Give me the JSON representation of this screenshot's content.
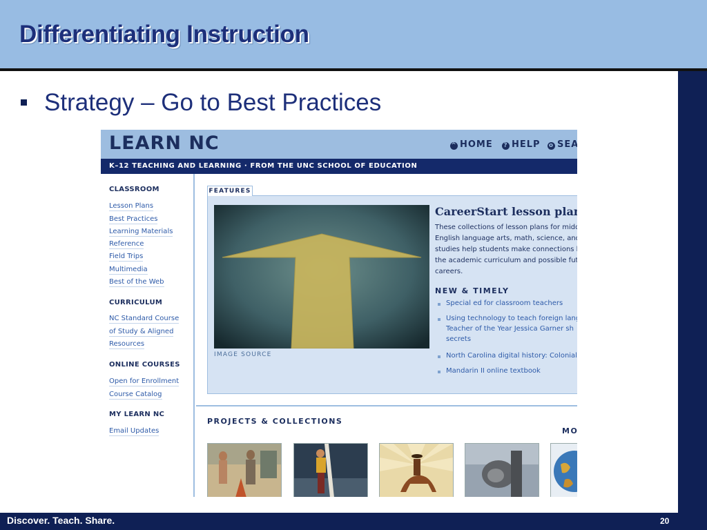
{
  "slide": {
    "title": "Differentiating Instruction",
    "bullet": "Strategy – Go to Best Practices",
    "footer": "Discover.  Teach.  Share.",
    "page_number": "20"
  },
  "site": {
    "logo": "LEARN NC",
    "nav": [
      {
        "icon": "home-icon",
        "label": "HOME"
      },
      {
        "icon": "help-icon",
        "label": "HELP"
      },
      {
        "icon": "search-icon",
        "label": "SEA"
      }
    ],
    "tagline": "K–12 TEACHING AND LEARNING · FROM THE UNC SCHOOL OF EDUCATION",
    "sidebar": {
      "classroom": {
        "heading": "CLASSROOM",
        "links": [
          "Lesson Plans",
          "Best Practices",
          "Learning Materials",
          "Reference",
          "Field Trips",
          "Multimedia",
          "Best of the Web"
        ]
      },
      "curriculum": {
        "heading": "CURRICULUM",
        "links": [
          "NC Standard Course",
          "of Study & Aligned",
          "Resources"
        ]
      },
      "online_courses": {
        "heading": "ONLINE COURSES",
        "links": [
          "Open for Enrollment",
          "Course Catalog"
        ]
      },
      "my_learn_nc": {
        "heading": "MY LEARN NC",
        "links": [
          "Email Updates"
        ]
      }
    },
    "features": {
      "tab": "FEATURES",
      "image_source": "IMAGE SOURCE",
      "title": "CareerStart lesson plan",
      "description": [
        "These collections of lesson plans for midd",
        "English language arts, math, science, and",
        "studies help students make connections b",
        "the academic curriculum and possible futu",
        "careers."
      ],
      "new_timely": {
        "heading": "NEW & TIMELY",
        "items": [
          [
            "Special ed for classroom teachers"
          ],
          [
            "Using technology to teach foreign lang",
            "Teacher of the Year Jessica Garner sh",
            "secrets"
          ],
          [
            "North Carolina digital history: Colonial"
          ],
          [
            "Mandarin II online textbook"
          ]
        ]
      }
    },
    "projects": {
      "heading": "PROJECTS & COLLECTIONS",
      "more": "MO"
    }
  },
  "colors": {
    "title_bar": "#98bce3",
    "navy": "#0f2055",
    "title_text": "#1d2f7a",
    "site_blue_light": "#9dbde0",
    "site_blue_dark": "#14296a"
  }
}
